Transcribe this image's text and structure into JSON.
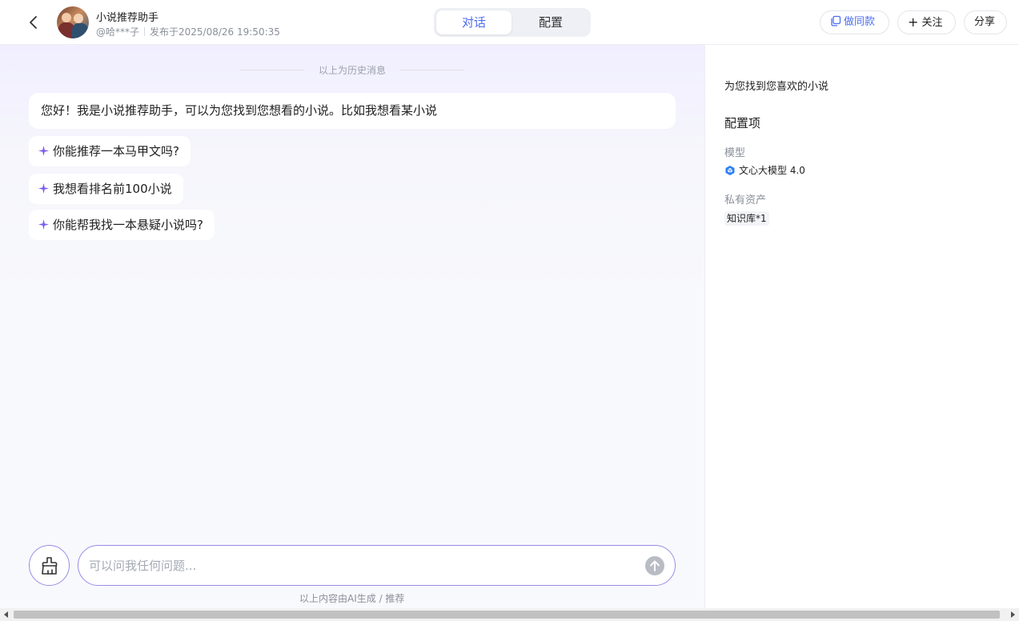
{
  "header": {
    "bot_name": "小说推荐助手",
    "author": "@哈***子",
    "published": "发布于2025/08/26 19:50:35",
    "tabs": [
      {
        "label": "对话",
        "active": true
      },
      {
        "label": "配置",
        "active": false
      }
    ],
    "copy_label": "做同款",
    "follow_label": "关注",
    "share_label": "分享"
  },
  "chat": {
    "history_label": "以上为历史消息",
    "greeting": "您好！我是小说推荐助手，可以为您找到您想看的小说。比如我想看某小说",
    "suggestions": [
      "你能推荐一本马甲文吗?",
      "我想看排名前100小说",
      "你能帮我找一本悬疑小说吗?"
    ],
    "input_placeholder": "可以问我任何问题...",
    "disclaimer": "以上内容由AI生成 / 推荐"
  },
  "panel": {
    "description": "为您找到您喜欢的小说",
    "config_title": "配置项",
    "model_label": "模型",
    "model_value": "文心大模型 4.0",
    "assets_label": "私有资产",
    "assets_value": "知识库*1"
  },
  "colors": {
    "accent": "#4e6ef2",
    "sparkle": "#7b5cf0",
    "input_border": "#9a8be8"
  }
}
